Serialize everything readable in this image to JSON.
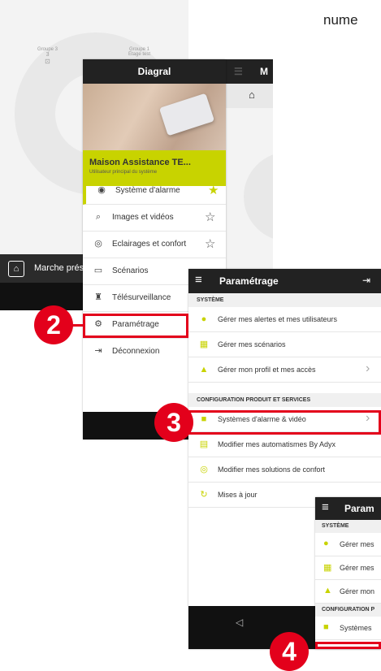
{
  "top_text": "nume",
  "screen0": {
    "segments": [
      {
        "name": "Groupe 3",
        "value": "3",
        "icon": "lock-icon"
      },
      {
        "name": "Groupe 1",
        "value": "Etage test"
      }
    ],
    "bottom_label": "Marche prés"
  },
  "screen1": {
    "title": "Diagral",
    "house_name": "Maison Assistance TE...",
    "house_subtitle": "Utilisateur principal du système",
    "menu": [
      {
        "label": "Système d'alarme",
        "icon": "alarm-icon",
        "starred": true
      },
      {
        "label": "Images et vidéos",
        "icon": "camera-icon",
        "starred": false
      },
      {
        "label": "Eclairages et confort",
        "icon": "bulb-icon",
        "starred": false
      },
      {
        "label": "Scénarios",
        "icon": "calendar-icon",
        "starred": false
      },
      {
        "label": "Télésurveillance",
        "icon": "guard-icon",
        "starred": false
      },
      {
        "label": "Paramétrage",
        "icon": "gear-icon",
        "starred": false
      },
      {
        "label": "Déconnexion",
        "icon": "logout-icon",
        "starred": false
      }
    ],
    "right_header_letter": "M"
  },
  "screen2": {
    "title": "Paramétrage",
    "sections": [
      {
        "title": "SYSTÈME",
        "items": [
          {
            "label": "Gérer mes alertes et mes utilisateurs",
            "icon": "user-icon"
          },
          {
            "label": "Gérer mes scénarios",
            "icon": "calendar-icon"
          },
          {
            "label": "Gérer mon profil et mes accès",
            "icon": "lock-icon",
            "chevron": true
          }
        ]
      },
      {
        "title": "CONFIGURATION PRODUIT ET SERVICES",
        "items": [
          {
            "label": "Systèmes d'alarme & vidéo",
            "icon": "video-icon",
            "chevron": true
          },
          {
            "label": "Modifier mes automatismes By Adyx",
            "icon": "automation-icon"
          },
          {
            "label": "Modifier mes solutions de confort",
            "icon": "bulb-icon"
          },
          {
            "label": "Mises à jour",
            "icon": "refresh-icon"
          }
        ]
      }
    ]
  },
  "screen3": {
    "title": "Param",
    "sections": [
      {
        "title": "SYSTÈME",
        "items": [
          {
            "label": "Gérer mes",
            "icon": "user-icon"
          },
          {
            "label": "Gérer mes",
            "icon": "calendar-icon"
          },
          {
            "label": "Gérer mon",
            "icon": "lock-icon"
          }
        ]
      },
      {
        "title": "CONFIGURATION P",
        "items": [
          {
            "label": "Systèmes",
            "icon": "video-icon"
          }
        ]
      }
    ]
  },
  "steps": [
    "2",
    "3",
    "4"
  ],
  "colors": {
    "accent": "#c8d300",
    "highlight": "#e3001b",
    "header": "#222222"
  }
}
